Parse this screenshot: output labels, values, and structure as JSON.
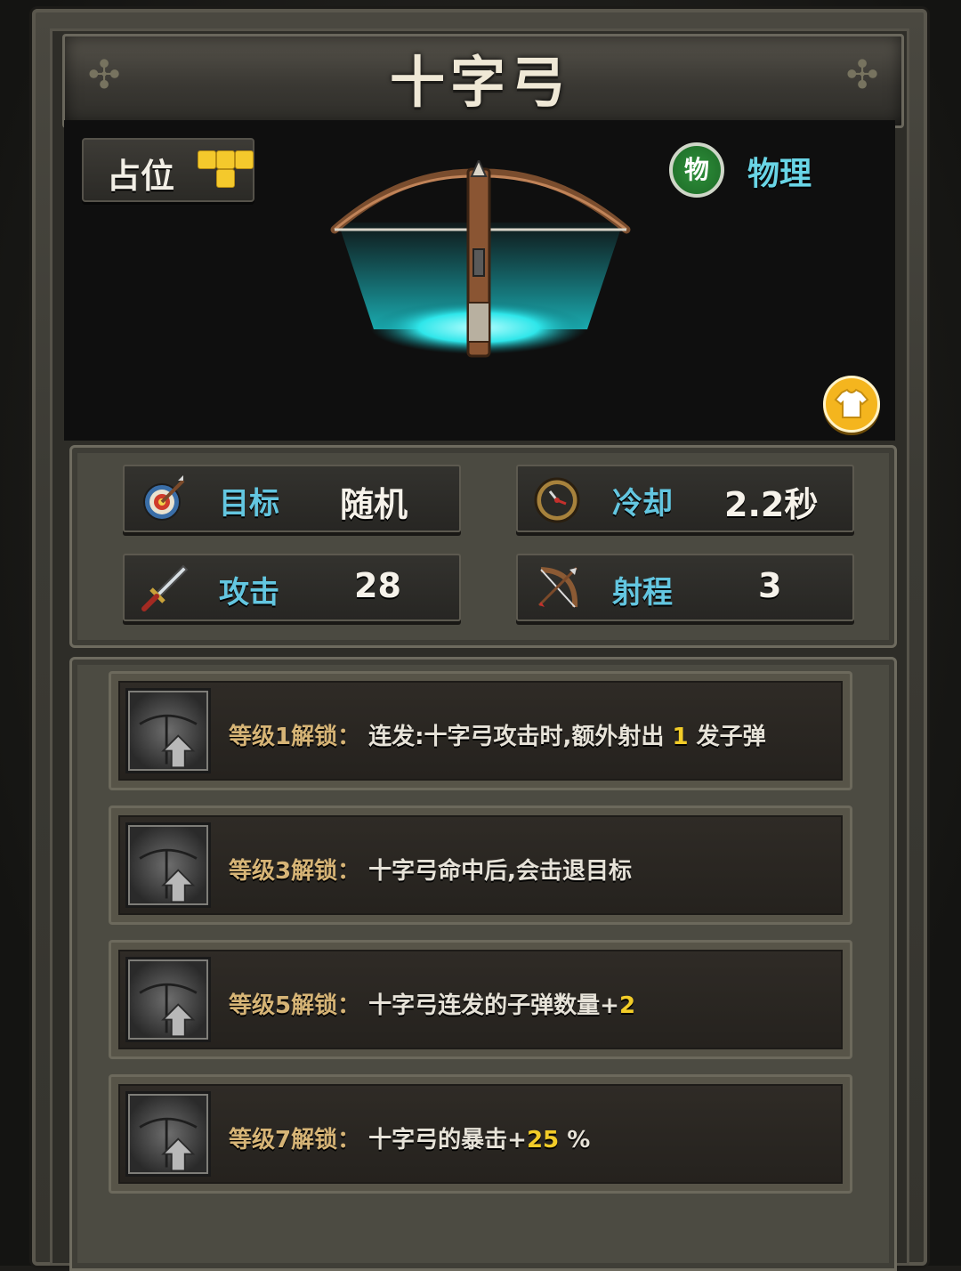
{
  "title": "十字弓",
  "placement": {
    "label": "占位"
  },
  "damage_type": {
    "badge": "物",
    "label": "物理"
  },
  "stats": [
    {
      "icon": "target-icon",
      "label": "目标",
      "value": "随机"
    },
    {
      "icon": "clock-icon",
      "label": "冷却",
      "value": "2.2秒"
    },
    {
      "icon": "sword-icon",
      "label": "攻击",
      "value": "28"
    },
    {
      "icon": "bow-icon",
      "label": "射程",
      "value": "3"
    }
  ],
  "unlocks": [
    {
      "level": "等级1解锁：",
      "desc_before": "连发:十字弓攻击时,额外射出",
      "num": "1",
      "desc_after": "发子弹"
    },
    {
      "level": "等级3解锁：",
      "desc_before": "十字弓命中后,会击退目标",
      "num": "",
      "desc_after": ""
    },
    {
      "level": "等级5解锁：",
      "desc_before": "十字弓连发的子弹数量+",
      "num": "2",
      "desc_after": ""
    },
    {
      "level": "等级7解锁：",
      "desc_before": "十字弓的暴击+",
      "num": "25",
      "desc_after": "%"
    }
  ],
  "colors": {
    "stat_label": "#63c6e0",
    "level_label": "#d6b476",
    "highlight_number": "#f2cc28",
    "physical_badge": "#2e8f3a",
    "placement_block": "#f4c92c"
  }
}
